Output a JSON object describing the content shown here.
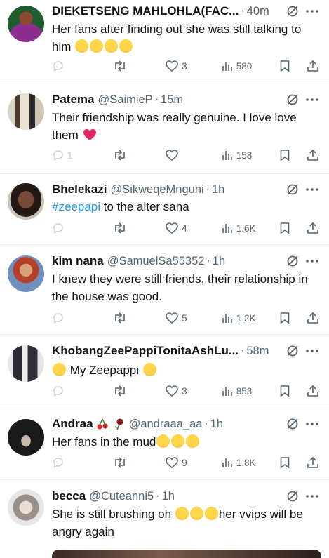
{
  "tweets": [
    {
      "name": "DIEKETSENG MAHLOHLA(FAC...",
      "handle": "",
      "time": "40m",
      "text": "Her fans after finding out she was still talking to him",
      "emojis": [
        "joy-emoji",
        "joy-emoji",
        "joy-emoji",
        "joy-emoji"
      ],
      "likes": "3",
      "views": "580",
      "replies": "",
      "avatar_color": "#6b2a6e"
    },
    {
      "name": "Patema",
      "handle": "@SaimieP",
      "time": "15m",
      "text": "Their friendship was really genuine. I love love them",
      "emojis": [
        "red-heart-emoji"
      ],
      "likes": "",
      "views": "158",
      "replies": "1",
      "avatar_color": "#7b6a52"
    },
    {
      "name": "Bhelekazi",
      "handle": "@SikweqeMnguni",
      "time": "1h",
      "hashtag": "#zeepapi",
      "text": "to the alter sana",
      "likes": "4",
      "views": "1.6K",
      "replies": "",
      "avatar_color": "#3b2a25"
    },
    {
      "name": "kim nana",
      "handle": "@SamuelSa55352",
      "time": "1h",
      "text": "I knew they were still friends, their relationship in the house was good.",
      "likes": "5",
      "views": "1.2K",
      "replies": "",
      "avatar_color": "#c46a4a"
    },
    {
      "name": "KhobangZeePappiTonitaAshLu...",
      "handle": "",
      "time": "58m",
      "text": "My Zeepappi",
      "emojis": [
        "relieved-emoji",
        "kiss-emoji"
      ],
      "likes": "3",
      "views": "853",
      "replies": "",
      "avatar_color": "#2d2d35"
    },
    {
      "name": "Andraa",
      "handle": "@andraaa_aa",
      "time": "1h",
      "text": "Her fans in the mud",
      "emojis": [
        "crying-emoji",
        "rofl-emoji",
        "rofl-emoji"
      ],
      "likes": "9",
      "views": "1.8K",
      "replies": "",
      "avatar_color": "#1c1c1c"
    },
    {
      "name": "becca",
      "handle": "@Cuteanni5",
      "time": "1h",
      "text_a": "She is still brushing oh",
      "text_b": "her vvips will be angry again",
      "emojis": [
        "rofl-emoji",
        "rofl-emoji",
        "rofl-emoji"
      ],
      "avatar_color": "#cfcfcf"
    }
  ],
  "colors": {
    "text": "#0f1419",
    "muted": "#536471",
    "link": "#1d9bf0",
    "divider": "#e6e9ec"
  }
}
